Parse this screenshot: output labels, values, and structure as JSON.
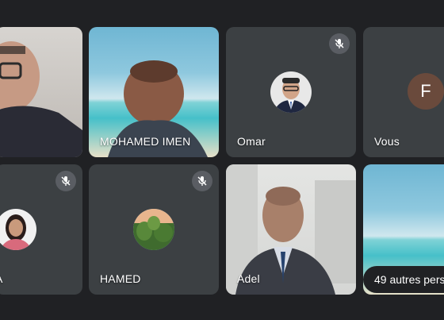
{
  "participants": [
    {
      "name": "",
      "muted": false
    },
    {
      "name": "MOHAMED IMEN",
      "muted": false
    },
    {
      "name": "Omar",
      "muted": true
    },
    {
      "name": "Vous",
      "muted": false,
      "initial": "F"
    },
    {
      "name": "A",
      "muted": true
    },
    {
      "name": "HAMED",
      "muted": true
    },
    {
      "name": "Adel",
      "muted": false
    }
  ],
  "more_participants_label": "49 autres pers",
  "icons": {
    "mute": "mic-off-icon"
  },
  "colors": {
    "background": "#202124",
    "tile": "#3c4043",
    "avatar_f": "#6a4a3c"
  }
}
